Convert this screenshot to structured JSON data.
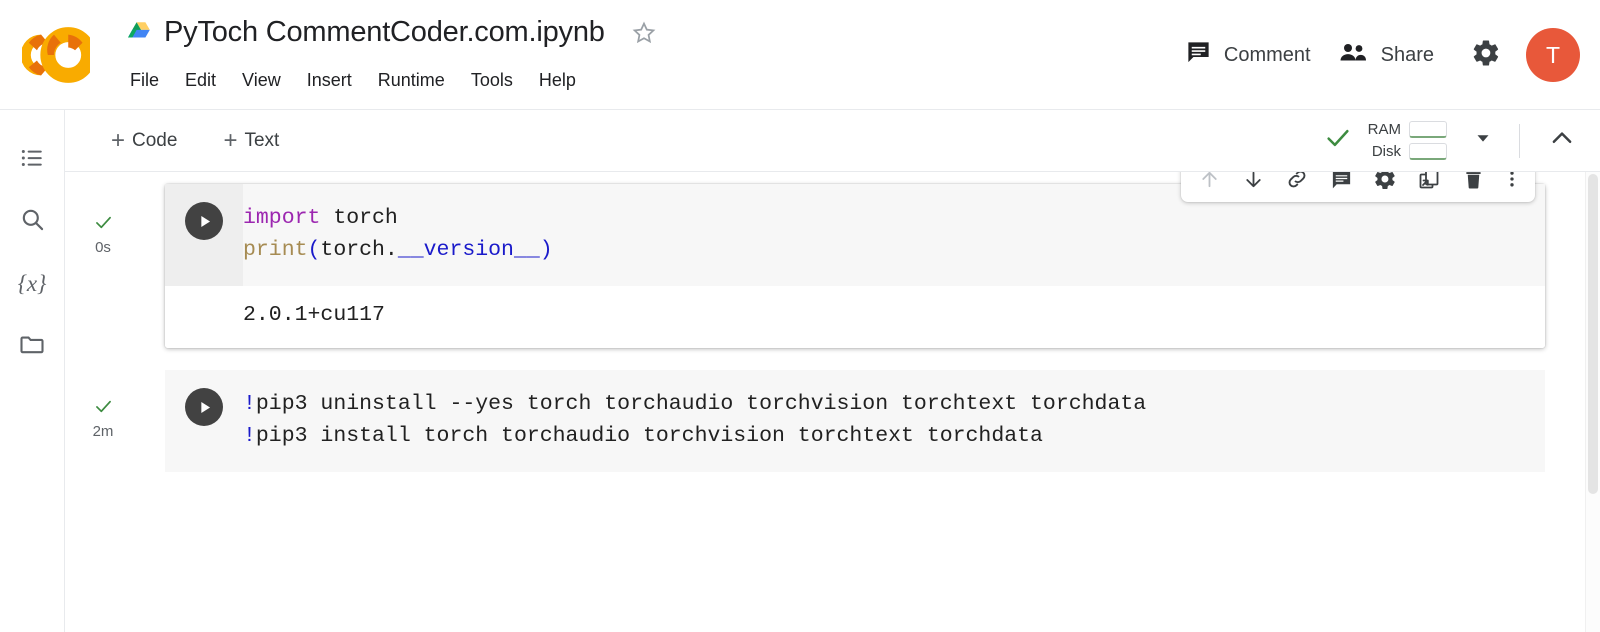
{
  "header": {
    "logo_name": "colab-logo",
    "doc_title": "PyToch CommentCoder.com.ipynb",
    "drive_icon": "drive-icon",
    "star_icon": "star-icon",
    "menu_items": [
      {
        "label": "File"
      },
      {
        "label": "Edit"
      },
      {
        "label": "View"
      },
      {
        "label": "Insert"
      },
      {
        "label": "Runtime"
      },
      {
        "label": "Tools"
      },
      {
        "label": "Help"
      }
    ],
    "comment_label": "Comment",
    "share_label": "Share",
    "settings_icon": "gear-icon",
    "avatar_initial": "T",
    "avatar_color": "#e8583a"
  },
  "sidebar": {
    "items": [
      {
        "name": "table-of-contents",
        "icon": "list-icon"
      },
      {
        "name": "find-and-replace",
        "icon": "search-icon"
      },
      {
        "name": "variables",
        "icon": "variables-icon",
        "glyph": "{x}"
      },
      {
        "name": "files",
        "icon": "folder-icon"
      }
    ]
  },
  "toolbar": {
    "add_code_label": "Code",
    "add_text_label": "Text",
    "plus_glyph": "+",
    "connected_icon": "checkmark-icon",
    "ram_label": "RAM",
    "disk_label": "Disk",
    "dropdown_icon": "chevron-down-icon",
    "collapse_icon": "chevron-up-icon"
  },
  "cell_toolbar": {
    "buttons": [
      {
        "name": "move-cell-up-button",
        "icon": "arrow-up-icon",
        "disabled": true
      },
      {
        "name": "move-cell-down-button",
        "icon": "arrow-down-icon",
        "disabled": false
      },
      {
        "name": "copy-link-to-cell-button",
        "icon": "link-icon",
        "disabled": false
      },
      {
        "name": "add-comment-button",
        "icon": "comment-icon",
        "disabled": false
      },
      {
        "name": "cell-settings-button",
        "icon": "gear-icon",
        "disabled": false
      },
      {
        "name": "mirror-cell-in-tab-button",
        "icon": "open-in-new-icon",
        "disabled": false
      },
      {
        "name": "delete-cell-button",
        "icon": "trash-icon",
        "disabled": false
      },
      {
        "name": "more-cell-actions-button",
        "icon": "more-vert-icon",
        "disabled": false
      }
    ]
  },
  "cells": [
    {
      "name": "code-cell-1",
      "selected": true,
      "status_icon": "checkmark-icon",
      "duration": "0s",
      "run_icon": "play-icon",
      "code_lines": [
        [
          {
            "t": "import",
            "c": "kw"
          },
          {
            "t": " torch",
            "c": "plain"
          }
        ],
        [
          {
            "t": "print",
            "c": "fn"
          },
          {
            "t": "(",
            "c": "punc"
          },
          {
            "t": "torch.",
            "c": "plain"
          },
          {
            "t": "__version__",
            "c": "attr"
          },
          {
            "t": ")",
            "c": "punc"
          }
        ]
      ],
      "output": "2.0.1+cu117"
    },
    {
      "name": "code-cell-2",
      "selected": false,
      "status_icon": "checkmark-icon",
      "duration": "2m",
      "run_icon": "play-icon",
      "code_lines": [
        [
          {
            "t": "!",
            "c": "bang"
          },
          {
            "t": "pip3 uninstall --yes torch torchaudio torchvision torchtext torchdata",
            "c": "plain"
          }
        ],
        [
          {
            "t": "!",
            "c": "bang"
          },
          {
            "t": "pip3 install torch torchaudio torchvision torchtext torchdata",
            "c": "plain"
          }
        ]
      ],
      "output": null
    }
  ]
}
